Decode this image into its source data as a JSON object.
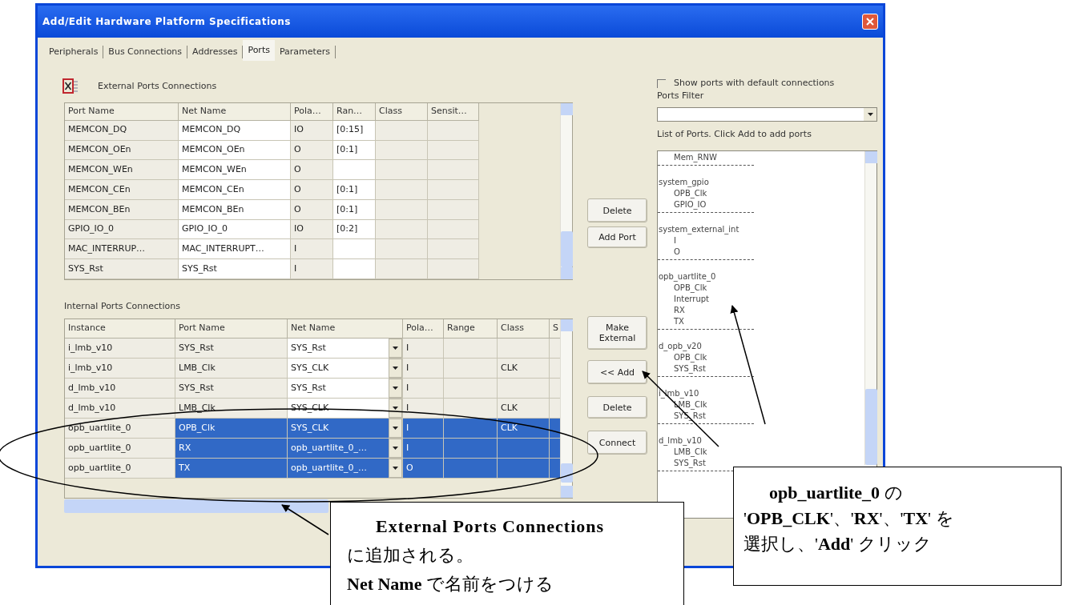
{
  "window": {
    "title": "Add/Edit Hardware Platform Specifications"
  },
  "tabs": [
    {
      "label": "Peripherals",
      "selected": false
    },
    {
      "label": "Bus Connections",
      "selected": false
    },
    {
      "label": "Addresses",
      "selected": false
    },
    {
      "label": "Ports",
      "selected": true
    },
    {
      "label": "Parameters",
      "selected": false
    }
  ],
  "external_ports": {
    "title": "External Ports Connections",
    "columns": [
      "Port Name",
      "Net Name",
      "Pola…",
      "Ran…",
      "Class",
      "Sensit…"
    ],
    "rows": [
      [
        "MEMCON_DQ",
        "MEMCON_DQ",
        "IO",
        "[0:15]"
      ],
      [
        "MEMCON_OEn",
        "MEMCON_OEn",
        "O",
        "[0:1]"
      ],
      [
        "MEMCON_WEn",
        "MEMCON_WEn",
        "O"
      ],
      [
        "MEMCON_CEn",
        "MEMCON_CEn",
        "O",
        "[0:1]"
      ],
      [
        "MEMCON_BEn",
        "MEMCON_BEn",
        "O",
        "[0:1]"
      ],
      [
        "GPIO_IO_0",
        "GPIO_IO_0",
        "IO",
        "[0:2]"
      ],
      [
        "MAC_INTERRUP…",
        "MAC_INTERRUPT…",
        "I"
      ],
      [
        "SYS_Rst",
        "SYS_Rst",
        "I"
      ]
    ]
  },
  "external_buttons": [
    "Delete",
    "Add Port"
  ],
  "internal_ports": {
    "title": "Internal Ports Connections",
    "columns": [
      "Instance",
      "Port Name",
      "Net Name",
      "Pola…",
      "Range",
      "Class",
      "S"
    ],
    "rows": [
      {
        "instance": "i_lmb_v10",
        "port_name": "SYS_Rst",
        "net_name": "SYS_Rst",
        "polarity": "I",
        "selected": false
      },
      {
        "instance": "i_lmb_v10",
        "port_name": "LMB_Clk",
        "net_name": "SYS_CLK",
        "polarity": "I",
        "class": "CLK",
        "selected": false
      },
      {
        "instance": "d_lmb_v10",
        "port_name": "SYS_Rst",
        "net_name": "SYS_Rst",
        "polarity": "I",
        "selected": false
      },
      {
        "instance": "d_lmb_v10",
        "port_name": "LMB_Clk",
        "net_name": "SYS_CLK",
        "polarity": "I",
        "class": "CLK",
        "selected": false
      },
      {
        "instance": "opb_uartlite_0",
        "port_name": "OPB_Clk",
        "net_name": "SYS_CLK",
        "polarity": "I",
        "class": "CLK",
        "selected": true
      },
      {
        "instance": "opb_uartlite_0",
        "port_name": "RX",
        "net_name": "opb_uartlite_0_…",
        "polarity": "I",
        "selected": true
      },
      {
        "instance": "opb_uartlite_0",
        "port_name": "TX",
        "net_name": "opb_uartlite_0_…",
        "polarity": "O",
        "selected": true
      }
    ]
  },
  "internal_buttons": [
    "Make External",
    "<< Add",
    "Delete",
    "Connect"
  ],
  "right_panel": {
    "show_default": {
      "label": "Show ports with default connections",
      "checked": false
    },
    "filter_label": "Ports Filter",
    "list_label": "List of Ports. Click Add to add ports",
    "port_groups": [
      {
        "ports": [
          "Mem_RNW"
        ]
      },
      {
        "name": "system_gpio",
        "ports": [
          "OPB_Clk",
          "GPIO_IO"
        ]
      },
      {
        "name": "system_external_int",
        "ports": [
          "I",
          "O"
        ]
      },
      {
        "name": "opb_uartlite_0",
        "ports": [
          "OPB_Clk",
          "Interrupt",
          "RX",
          "TX"
        ]
      },
      {
        "name": "d_opb_v20",
        "ports": [
          "OPB_Clk",
          "SYS_Rst"
        ]
      },
      {
        "name": "i_lmb_v10",
        "ports": [
          "LMB_Clk",
          "SYS_Rst"
        ]
      },
      {
        "name": "d_lmb_v10",
        "ports": [
          "LMB_Clk",
          "SYS_Rst"
        ]
      }
    ]
  },
  "callouts": [
    {
      "lines": [
        "External Ports Connections",
        "に追加される。",
        "**Net Name** で名前をつける"
      ]
    },
    {
      "lines": [
        "**opb_uartlite_0** の",
        "'**OPB_CLK**'、'**RX**'、'**TX**' を",
        "選択し、'**Add**' クリック"
      ]
    }
  ]
}
